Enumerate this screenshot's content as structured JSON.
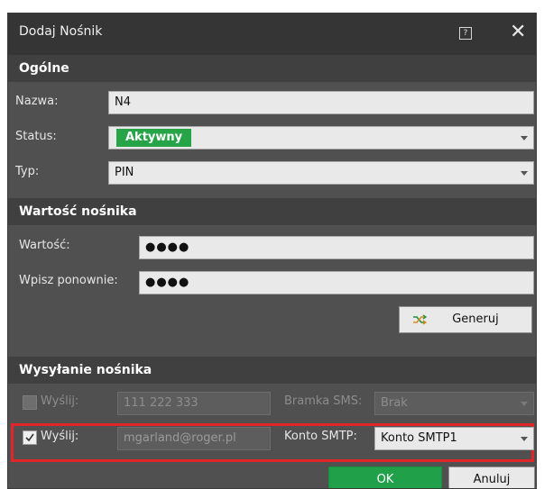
{
  "window": {
    "title": "Dodaj Nośnik",
    "help_glyph": "?",
    "close_glyph": "✕"
  },
  "general": {
    "header": "Ogólne",
    "name_label": "Nazwa:",
    "name_value": "N4",
    "status_label": "Status:",
    "status_value": "Aktywny",
    "status_color": "#27a448",
    "type_label": "Typ:",
    "type_value": "PIN"
  },
  "value": {
    "header": "Wartość nośnika",
    "value_label": "Wartość:",
    "value_masked": "●●●●",
    "repeat_label": "Wpisz ponownie:",
    "repeat_masked": "●●●●",
    "generate_label": "Generuj",
    "generate_icon": "shuffle-icon"
  },
  "sending": {
    "header": "Wysyłanie nośnika",
    "sms_send_label": "Wyślij:",
    "sms_checked": false,
    "sms_number": "111 222 333",
    "gateway_label": "Bramka SMS:",
    "gateway_value": "Brak",
    "email_send_label": "Wyślij:",
    "email_checked": true,
    "email_value": "mgarland@roger.pl",
    "smtp_label": "Konto SMTP:",
    "smtp_value": "Konto SMTP1",
    "highlight_color": "#e0262b"
  },
  "footer": {
    "ok_label": "OK",
    "cancel_label": "Anuluj",
    "ok_color": "#21a04a"
  }
}
